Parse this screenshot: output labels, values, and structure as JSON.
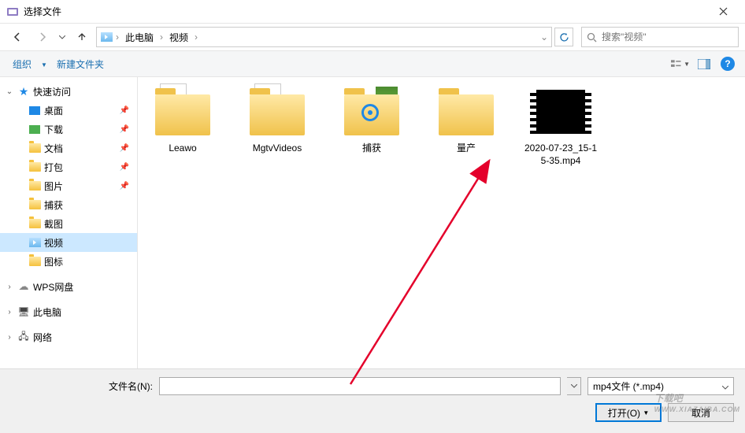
{
  "window": {
    "title": "选择文件"
  },
  "nav": {
    "crumbs": [
      "此电脑",
      "视频"
    ],
    "search_placeholder": "搜索\"视频\""
  },
  "toolbar": {
    "organize": "组织",
    "new_folder": "新建文件夹"
  },
  "sidebar": {
    "quick": "快速访问",
    "items": [
      {
        "label": "桌面",
        "pinned": true,
        "icon": "blue"
      },
      {
        "label": "下载",
        "pinned": true,
        "icon": "green"
      },
      {
        "label": "文档",
        "pinned": true,
        "icon": "folder"
      },
      {
        "label": "打包",
        "pinned": true,
        "icon": "folder"
      },
      {
        "label": "图片",
        "pinned": true,
        "icon": "folder"
      },
      {
        "label": "捕获",
        "pinned": false,
        "icon": "folder"
      },
      {
        "label": "截图",
        "pinned": false,
        "icon": "folder"
      },
      {
        "label": "视频",
        "pinned": false,
        "icon": "video",
        "selected": true
      },
      {
        "label": "图标",
        "pinned": false,
        "icon": "folder"
      }
    ],
    "wps": "WPS网盘",
    "pc": "此电脑",
    "network": "网络"
  },
  "items": [
    {
      "label": "Leawo",
      "type": "folder-doc"
    },
    {
      "label": "MgtvVideos",
      "type": "folder-doc"
    },
    {
      "label": "捕获",
      "type": "folder-img"
    },
    {
      "label": "量产",
      "type": "folder"
    },
    {
      "label": "2020-07-23_15-15-35.mp4",
      "type": "video"
    }
  ],
  "footer": {
    "filename_label": "文件名(N):",
    "filename_value": "",
    "filter": "mp4文件 (*.mp4)",
    "open": "打开(O)",
    "cancel": "取消"
  },
  "watermark": {
    "main": "下载吧",
    "sub": "WWW.XIAZAIBA.COM"
  }
}
